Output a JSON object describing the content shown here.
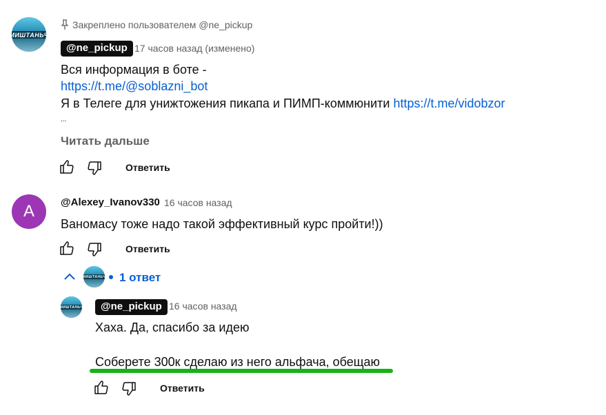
{
  "comments": {
    "pinned": {
      "pinned_label": "Закреплено пользователем @ne_pickup",
      "author": "@ne_pickup",
      "time": "17 часов назад (изменено)",
      "avatar_text": "МИШТАНЬЧ",
      "line1": "Вся информация в боте -",
      "link1": "https://t.me/@soblazni_bot",
      "line3_text": "Я в Телеге для унижтожения пикапа и ПИМП-коммюнити",
      "line3_link": "https://t.me/vidobzor",
      "ellipsis": "...",
      "read_more": "Читать дальше",
      "reply_label": "Ответить"
    },
    "second": {
      "avatar_letter": "A",
      "avatar_color": "#9c36b5",
      "author": "@Alexey_Ivanov330",
      "time": "16 часов назад",
      "text": "Ваномасу тоже надо такой эффективный курс пройти!))",
      "reply_label": "Ответить",
      "replies_count_label": "1 ответ"
    },
    "reply": {
      "author": "@ne_pickup",
      "time": "16 часов назад",
      "avatar_text": "МИШТАНЬЧ",
      "line1": "Хаха. Да, спасибо за идею",
      "line2": "Соберете 300к сделаю из него альфача, обещаю",
      "reply_label": "Ответить"
    }
  },
  "colors": {
    "link": "#065fd4",
    "highlight_underline": "#17b21a",
    "meta": "#606060"
  },
  "icons": [
    "pin-icon",
    "like-icon",
    "dislike-icon",
    "chevron-up-icon"
  ]
}
